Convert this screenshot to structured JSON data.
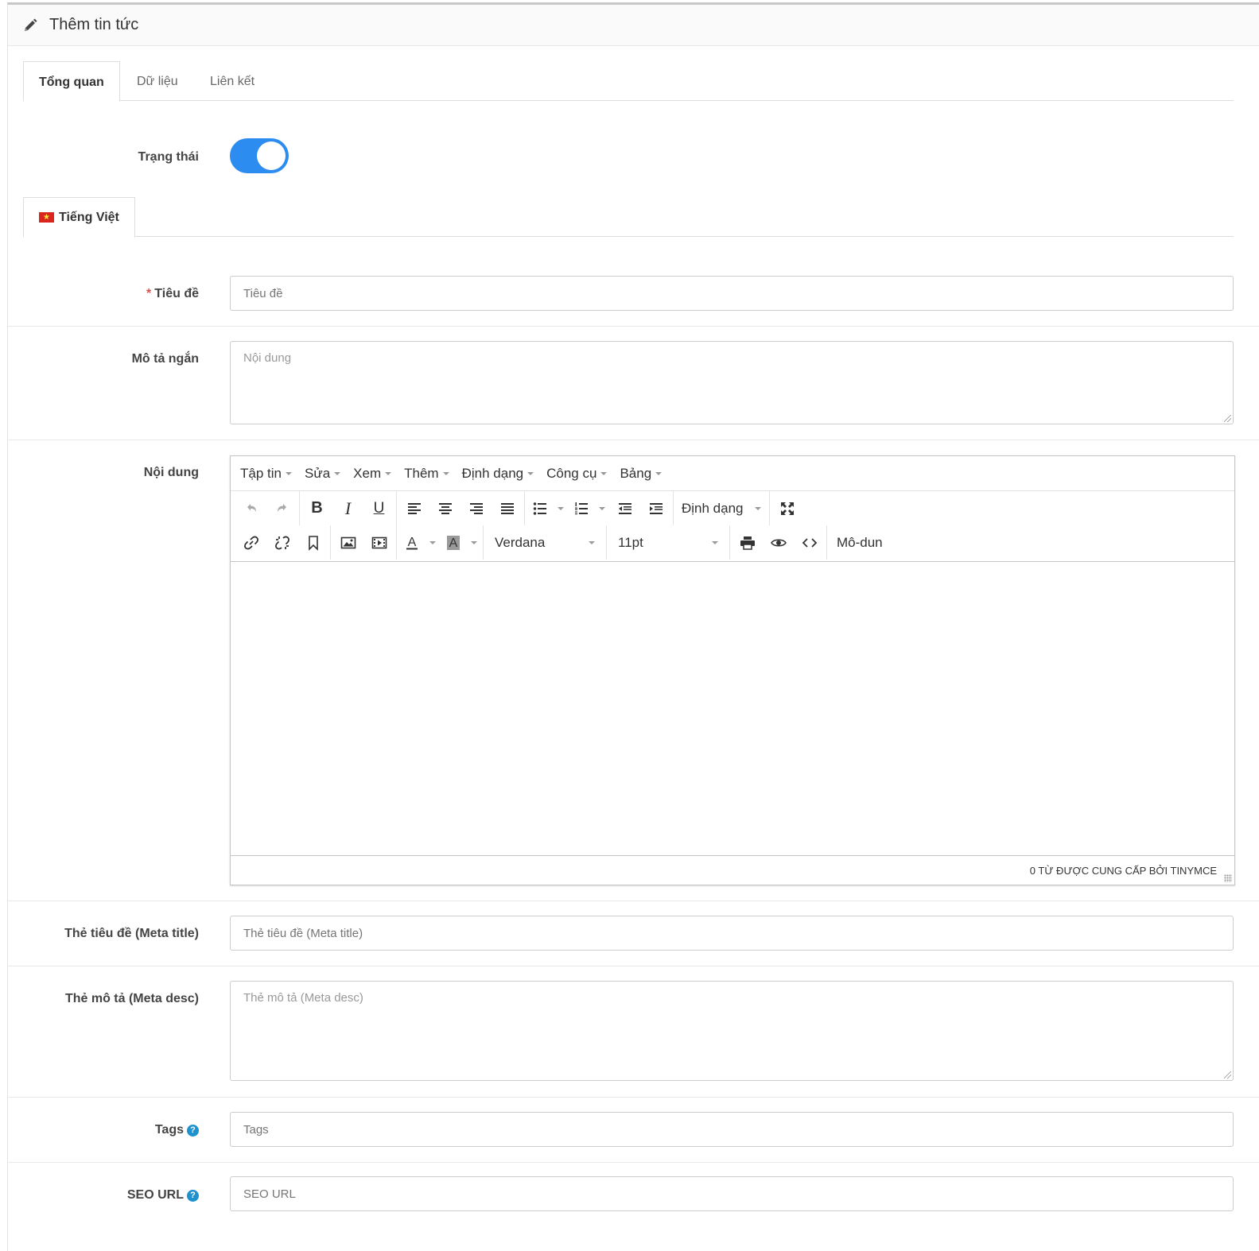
{
  "header": {
    "title": "Thêm tin tức",
    "icon": "pencil-icon"
  },
  "tabs": [
    {
      "label": "Tổng quan",
      "active": true
    },
    {
      "label": "Dữ liệu",
      "active": false
    },
    {
      "label": "Liên kết",
      "active": false
    }
  ],
  "status": {
    "label": "Trạng thái",
    "enabled": true,
    "color": "#2d8cf0"
  },
  "language_tab": {
    "label": "Tiếng Việt",
    "flag": "vietnam-flag-icon"
  },
  "fields": {
    "title": {
      "label": "Tiêu đề",
      "required_mark": "*",
      "placeholder": "Tiêu đề",
      "value": ""
    },
    "short_desc": {
      "label": "Mô tả ngắn",
      "placeholder": "Nội dung",
      "value": ""
    },
    "content": {
      "label": "Nội dung"
    },
    "meta_title": {
      "label": "Thẻ tiêu đề (Meta title)",
      "placeholder": "Thẻ tiêu đề (Meta title)",
      "value": ""
    },
    "meta_desc": {
      "label": "Thẻ mô tả (Meta desc)",
      "placeholder": "Thẻ mô tả (Meta desc)",
      "value": ""
    },
    "tags": {
      "label": "Tags",
      "placeholder": "Tags",
      "value": "",
      "help_icon": "question-icon"
    },
    "seo_url": {
      "label": "SEO URL",
      "placeholder": "SEO URL",
      "value": "",
      "help_icon": "question-icon"
    }
  },
  "editor": {
    "menu": [
      "Tập tin",
      "Sửa",
      "Xem",
      "Thêm",
      "Định dạng",
      "Công cụ",
      "Bảng"
    ],
    "format_select": "Định dạng",
    "font_family": "Verdana",
    "font_size": "11pt",
    "module_button": "Mô-dun",
    "status_text": "0 TỪ ĐƯỢC CUNG CẤP BỞI TINYMCE"
  }
}
